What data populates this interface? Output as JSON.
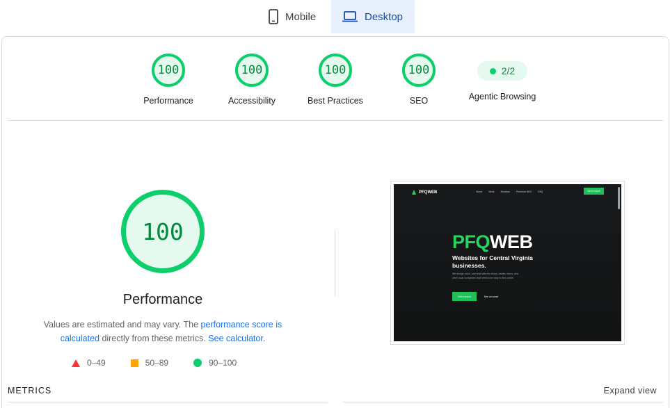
{
  "tabs": [
    {
      "label": "Mobile",
      "icon": "mobile-phone-icon",
      "selected": false
    },
    {
      "label": "Desktop",
      "icon": "laptop-icon",
      "selected": true
    }
  ],
  "categories": [
    {
      "score": "100",
      "label": "Performance"
    },
    {
      "score": "100",
      "label": "Accessibility"
    },
    {
      "score": "100",
      "label": "Best Practices"
    },
    {
      "score": "100",
      "label": "SEO"
    }
  ],
  "agentic": {
    "value": "2/2",
    "label": "Agentic Browsing"
  },
  "main": {
    "score": "100",
    "title": "Performance",
    "desc_prefix": "Values are estimated and may vary. The ",
    "desc_link1": "performance score is calculated",
    "desc_middle": " directly from these metrics. ",
    "desc_link2": "See calculator",
    "desc_suffix": "."
  },
  "legend": [
    {
      "shape": "triangle",
      "range": "0–49",
      "color": "#ff3333"
    },
    {
      "shape": "square",
      "range": "50–89",
      "color": "#ffa400"
    },
    {
      "shape": "circle",
      "range": "90–100",
      "color": "#0cce6b"
    }
  ],
  "preview": {
    "logo": "PFQWEB",
    "nav_links": [
      "Home",
      "Work",
      "Services",
      "Premium SEO",
      "FAQ"
    ],
    "nav_cta": "Get in touch",
    "hero_title_left": "PFQ",
    "hero_title_right": "WEB",
    "hero_sub": "Websites for Central Virginia businesses.",
    "hero_body": "We design, build, and host sites for shops, trades, farms, and other local companies that need to be easy to find online.",
    "primary_button": "Get in touch",
    "secondary_button": "See our work"
  },
  "metrics": {
    "label": "METRICS",
    "expand": "Expand view"
  },
  "colors": {
    "pass": "#0cce6b",
    "pass_bg": "#e6f9ee",
    "pass_text": "#008a3e",
    "link": "#1a73e8",
    "tab_active_bg": "#e8f0fe"
  }
}
